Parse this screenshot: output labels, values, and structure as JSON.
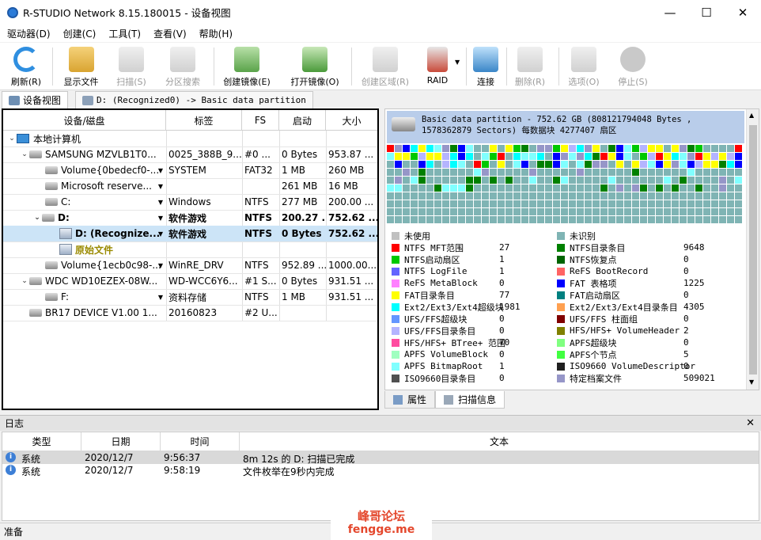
{
  "window": {
    "title": "R-STUDIO Network 8.15.180015 - 设备视图",
    "min": "—",
    "max": "☐",
    "close": "✕"
  },
  "menu": [
    "驱动器(D)",
    "创建(C)",
    "工具(T)",
    "查看(V)",
    "帮助(H)"
  ],
  "toolbar": [
    {
      "label": "刷新(R)",
      "icon": "refresh-icon",
      "enabled": true,
      "color": "#2f8fe0"
    },
    {
      "label": "显示文件",
      "icon": "show-files-icon",
      "enabled": true,
      "color": "#e7b54a"
    },
    {
      "label": "扫描(S)",
      "icon": "scan-icon",
      "enabled": false,
      "color": "#8a8a8a"
    },
    {
      "label": "分区搜索",
      "icon": "partition-search-icon",
      "enabled": false,
      "color": "#8a8a8a"
    },
    {
      "label": "创建镜像(E)",
      "icon": "create-image-icon",
      "enabled": true,
      "color": "#5aa34a"
    },
    {
      "label": "打开镜像(O)",
      "icon": "open-image-icon",
      "enabled": true,
      "color": "#4a9a3a"
    },
    {
      "label": "创建区域(R)",
      "icon": "create-region-icon",
      "enabled": false,
      "color": "#8a8a8a"
    },
    {
      "label": "RAID",
      "icon": "raid-icon",
      "enabled": true,
      "color": "#c94a3a"
    },
    {
      "label": "连接",
      "icon": "connect-icon",
      "enabled": true,
      "color": "#3a86c8"
    },
    {
      "label": "删除(R)",
      "icon": "delete-icon",
      "enabled": false,
      "color": "#8a8a8a"
    },
    {
      "label": "选项(O)",
      "icon": "options-icon",
      "enabled": false,
      "color": "#8a8a8a"
    },
    {
      "label": "停止(S)",
      "icon": "stop-icon",
      "enabled": false,
      "color": "#8a8a8a"
    }
  ],
  "tabs": [
    {
      "label": "设备视图"
    },
    {
      "label": "D: (Recognized0) -> Basic data partition"
    }
  ],
  "tree": {
    "columns": [
      "设备/磁盘",
      "标签",
      "FS",
      "启动",
      "大小"
    ],
    "rows": [
      {
        "name": "本地计算机",
        "label": "",
        "fs": "",
        "start": "",
        "size": "",
        "icon": "computer-icon",
        "expand": "⌄",
        "bold": false,
        "dd": false
      },
      {
        "name": "SAMSUNG MZVLB1T0...",
        "label": "0025_388B_9...",
        "fs": "#0 ...",
        "start": "0 Bytes",
        "size": "953.87 ...",
        "icon": "disk-icon",
        "expand": "⌄",
        "bold": false,
        "dd": false
      },
      {
        "name": "Volume{0bedecf0-...",
        "label": "SYSTEM",
        "fs": "FAT32",
        "start": "1 MB",
        "size": "260 MB",
        "icon": "volume-icon",
        "expand": "",
        "bold": false,
        "dd": true
      },
      {
        "name": "Microsoft reserve...",
        "label": "",
        "fs": "",
        "start": "261 MB",
        "size": "16 MB",
        "icon": "volume-icon",
        "expand": "",
        "bold": false,
        "dd": true
      },
      {
        "name": "C:",
        "label": "Windows",
        "fs": "NTFS",
        "start": "277 MB",
        "size": "200.00 ...",
        "icon": "volume-icon",
        "expand": "",
        "bold": false,
        "dd": true
      },
      {
        "name": "D:",
        "label": "软件游戏",
        "fs": "NTFS",
        "start": "200.27 ...",
        "size": "752.62 ...",
        "icon": "volume-icon",
        "expand": "⌄",
        "bold": true,
        "dd": true
      },
      {
        "name": "D: (Recognize...",
        "label": "软件游戏",
        "fs": "NTFS",
        "start": "0 Bytes",
        "size": "752.62 ...",
        "icon": "recognized-icon",
        "expand": "",
        "bold": true,
        "dd": true
      },
      {
        "name": "原始文件",
        "label": "",
        "fs": "",
        "start": "",
        "size": "",
        "icon": "recognized-icon",
        "expand": "",
        "bold": true,
        "dd": false
      },
      {
        "name": "Volume{1ecb0c98-...",
        "label": "WinRE_DRV",
        "fs": "NTFS",
        "start": "952.89 ...",
        "size": "1000.00...",
        "icon": "volume-icon",
        "expand": "",
        "bold": false,
        "dd": true
      },
      {
        "name": "WDC WD10EZEX-08W...",
        "label": "WD-WCC6Y6...",
        "fs": "#1 S...",
        "start": "0 Bytes",
        "size": "931.51 ...",
        "icon": "disk-icon",
        "expand": "⌄",
        "bold": false,
        "dd": false
      },
      {
        "name": "F:",
        "label": "资料存储",
        "fs": "NTFS",
        "start": "1 MB",
        "size": "931.51 ...",
        "icon": "volume-icon",
        "expand": "",
        "bold": false,
        "dd": true
      },
      {
        "name": "BR17 DEVICE V1.00 1...",
        "label": "20160823",
        "fs": "#2 U...",
        "start": "",
        "size": "",
        "icon": "disk-icon",
        "expand": "",
        "bold": false,
        "dd": false
      }
    ]
  },
  "partition": {
    "header": "Basic data partition - 752.62 GB (808121794048 Bytes , 1578362879 Sectors) 每数据块 4277407 扇区"
  },
  "legend": {
    "left": [
      {
        "label": "未使用",
        "value": "",
        "color": "#c0c0c0"
      },
      {
        "label": "NTFS MFT范围",
        "value": "27",
        "color": "#ff0000"
      },
      {
        "label": "NTFS启动扇区",
        "value": "1",
        "color": "#00c800"
      },
      {
        "label": "NTFS LogFile",
        "value": "1",
        "color": "#6464ff"
      },
      {
        "label": "ReFS MetaBlock",
        "value": "0",
        "color": "#ff80ff"
      },
      {
        "label": "FAT目录条目",
        "value": "77",
        "color": "#ffff00"
      },
      {
        "label": "Ext2/Ext3/Ext4超级块",
        "value": "1981",
        "color": "#00ffff"
      },
      {
        "label": "UFS/FFS超级块",
        "value": "0",
        "color": "#6496ff"
      },
      {
        "label": "UFS/FFS目录条目",
        "value": "0",
        "color": "#b4b4ff"
      },
      {
        "label": "HFS/HFS+ BTree+ 范围",
        "value": "70",
        "color": "#ff4ca0"
      },
      {
        "label": "APFS VolumeBlock",
        "value": "0",
        "color": "#a0ffc0"
      },
      {
        "label": "APFS BitmapRoot",
        "value": "1",
        "color": "#80ffff"
      },
      {
        "label": "ISO9660目录条目",
        "value": "0",
        "color": "#505050"
      }
    ],
    "right": [
      {
        "label": "未识别",
        "value": "",
        "color": "#7fb4b4"
      },
      {
        "label": "NTFS目录条目",
        "value": "9648",
        "color": "#008000"
      },
      {
        "label": "NTFS恢复点",
        "value": "0",
        "color": "#006400"
      },
      {
        "label": "ReFS BootRecord",
        "value": "0",
        "color": "#ff6464"
      },
      {
        "label": "FAT 表格项",
        "value": "1225",
        "color": "#0000ff"
      },
      {
        "label": "FAT启动扇区",
        "value": "0",
        "color": "#008080"
      },
      {
        "label": "Ext2/Ext3/Ext4目录条目",
        "value": "4305",
        "color": "#ffa050"
      },
      {
        "label": "UFS/FFS 柱面组",
        "value": "0",
        "color": "#800000"
      },
      {
        "label": "HFS/HFS+ VolumeHeader",
        "value": "2",
        "color": "#808000"
      },
      {
        "label": "APFS超级块",
        "value": "0",
        "color": "#80ff80"
      },
      {
        "label": "APFS个节点",
        "value": "5",
        "color": "#40ff40"
      },
      {
        "label": "ISO9660 VolumeDescriptor",
        "value": "0",
        "color": "#202020"
      },
      {
        "label": "特定档案文件",
        "value": "509021",
        "color": "#9696c8"
      }
    ]
  },
  "bottom_tabs": [
    {
      "label": "属性"
    },
    {
      "label": "扫描信息"
    }
  ],
  "log": {
    "title": "日志",
    "close": "✕",
    "columns": [
      "类型",
      "日期",
      "时间",
      "文本"
    ],
    "rows": [
      {
        "type": "系统",
        "date": "2020/12/7",
        "time": "9:56:37",
        "text": "8m 12s 的 D: 扫描已完成"
      },
      {
        "type": "系统",
        "date": "2020/12/7",
        "time": "9:58:19",
        "text": "文件枚举在9秒内完成"
      }
    ]
  },
  "status": "准备",
  "watermark": {
    "line1": "峰哥论坛",
    "line2": "fengge.me"
  }
}
